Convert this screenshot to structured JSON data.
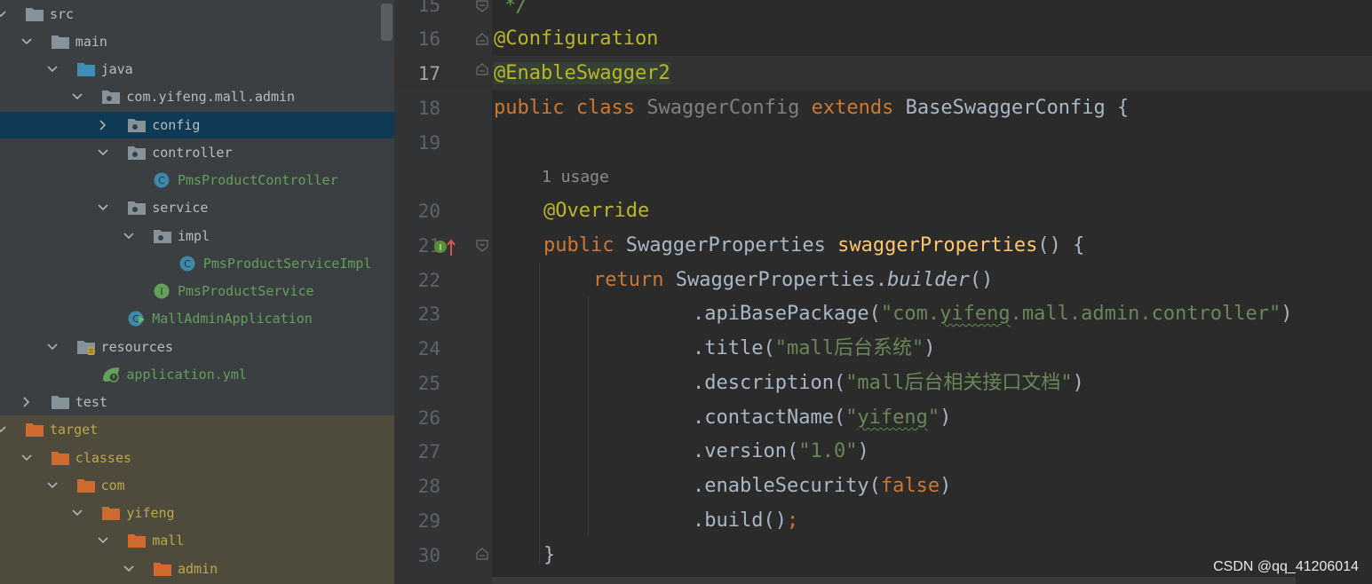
{
  "project_tree": [
    {
      "label": "src",
      "depth": 0,
      "arrow": "down",
      "icon": "folder-icon",
      "tone": "plain"
    },
    {
      "label": "main",
      "depth": 1,
      "arrow": "down",
      "icon": "folder-icon",
      "tone": "plain"
    },
    {
      "label": "java",
      "depth": 2,
      "arrow": "down",
      "icon": "source-folder-icon",
      "tone": "plain"
    },
    {
      "label": "com.yifeng.mall.admin",
      "depth": 3,
      "arrow": "down",
      "icon": "package-icon",
      "tone": "plain"
    },
    {
      "label": "config",
      "depth": 4,
      "arrow": "right",
      "icon": "package-icon",
      "tone": "plain",
      "selected": true
    },
    {
      "label": "controller",
      "depth": 4,
      "arrow": "down",
      "icon": "package-icon",
      "tone": "plain"
    },
    {
      "label": "PmsProductController",
      "depth": 5,
      "arrow": "none",
      "icon": "class-icon",
      "tone": "class"
    },
    {
      "label": "service",
      "depth": 4,
      "arrow": "down",
      "icon": "package-icon",
      "tone": "plain"
    },
    {
      "label": "impl",
      "depth": 5,
      "arrow": "down",
      "icon": "package-icon",
      "tone": "plain"
    },
    {
      "label": "PmsProductServiceImpl",
      "depth": 6,
      "arrow": "none",
      "icon": "class-icon",
      "tone": "class"
    },
    {
      "label": "PmsProductService",
      "depth": 5,
      "arrow": "none",
      "icon": "interface-icon",
      "tone": "class"
    },
    {
      "label": "MallAdminApplication",
      "depth": 4,
      "arrow": "none",
      "icon": "spring-app-icon",
      "tone": "class"
    },
    {
      "label": "resources",
      "depth": 2,
      "arrow": "down",
      "icon": "resources-folder-icon",
      "tone": "plain"
    },
    {
      "label": "application.yml",
      "depth": 3,
      "arrow": "none",
      "icon": "spring-yml-icon",
      "tone": "class"
    },
    {
      "label": "test",
      "depth": 1,
      "arrow": "right",
      "icon": "folder-icon",
      "tone": "plain"
    },
    {
      "label": "target",
      "depth": 0,
      "arrow": "down",
      "icon": "excluded-folder-icon",
      "tone": "olive"
    },
    {
      "label": "classes",
      "depth": 1,
      "arrow": "down",
      "icon": "excluded-folder-icon",
      "tone": "olive"
    },
    {
      "label": "com",
      "depth": 2,
      "arrow": "down",
      "icon": "excluded-folder-icon",
      "tone": "olive"
    },
    {
      "label": "yifeng",
      "depth": 3,
      "arrow": "down",
      "icon": "excluded-folder-icon",
      "tone": "olive"
    },
    {
      "label": "mall",
      "depth": 4,
      "arrow": "down",
      "icon": "excluded-folder-icon",
      "tone": "olive"
    },
    {
      "label": "admin",
      "depth": 5,
      "arrow": "down",
      "icon": "excluded-folder-icon",
      "tone": "olive"
    }
  ],
  "editor": {
    "line_numbers": [
      "15",
      "16",
      "17",
      "18",
      "19",
      "20",
      "21",
      "22",
      "23",
      "24",
      "25",
      "26",
      "27",
      "28",
      "29",
      "30"
    ],
    "current_line": "17",
    "usage_hint": "1 usage",
    "code": {
      "l15": "*/",
      "l16_ann": "@Configuration",
      "l17_ann": "@EnableSwagger2",
      "l18_kw1": "public",
      "l18_kw2": "class",
      "l18_name": "SwaggerConfig",
      "l18_kw3": "extends",
      "l18_base": "BaseSwaggerConfig {",
      "l20_ann": "@Override",
      "l21_kw": "public",
      "l21_type": "SwaggerProperties",
      "l21_fn": "swaggerProperties",
      "l21_tail": "() {",
      "l22_kw": "return",
      "l22_obj": "SwaggerProperties.",
      "l22_call": "builder",
      "l22_tail": "()",
      "l23_m": ".apiBasePackage(",
      "l23_s1": "\"com.",
      "l23_s2": "yifeng",
      "l23_s3": ".mall.admin.controller\"",
      "l23_t": ")",
      "l24_m": ".title(",
      "l24_s": "\"mall后台系统\"",
      "l24_t": ")",
      "l25_m": ".description(",
      "l25_s": "\"mall后台相关接口文档\"",
      "l25_t": ")",
      "l26_m": ".contactName(",
      "l26_s1": "\"",
      "l26_s2": "yifeng",
      "l26_s3": "\"",
      "l26_t": ")",
      "l27_m": ".version(",
      "l27_s": "\"1.0\"",
      "l27_t": ")",
      "l28_m": ".enableSecurity(",
      "l28_kw": "false",
      "l28_t": ")",
      "l29_m": ".build()",
      "l29_semi": ";",
      "l30": "}"
    }
  },
  "watermark": "CSDN @qq_41206014",
  "colors": {
    "keyword": "#cc7832",
    "annotation": "#bbb529",
    "string": "#6a8759",
    "method": "#ffc66d",
    "selection": "#0e3a55"
  }
}
